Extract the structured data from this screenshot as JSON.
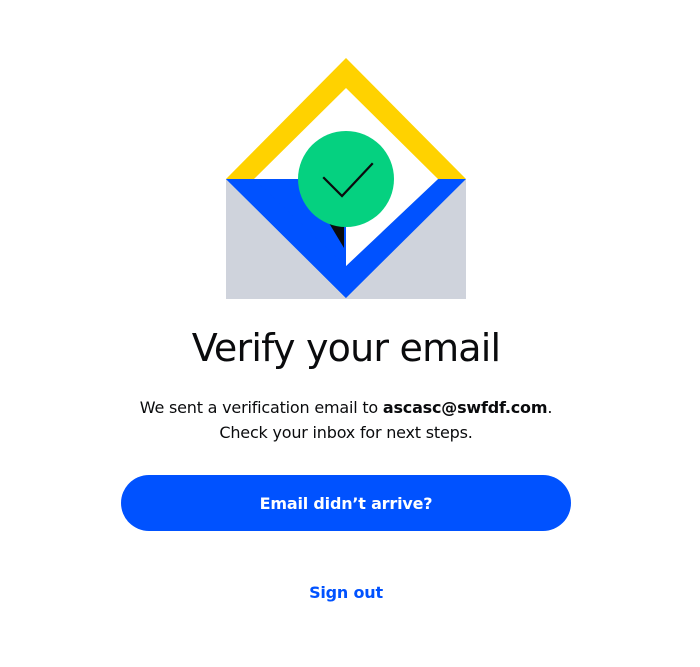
{
  "illustration": {
    "icon": "envelope-checkmark-icon",
    "colors": {
      "flap": "#ffd200",
      "envelope_body": "#cfd3dc",
      "envelope_front": "#0052ff",
      "check_circle": "#05d180",
      "letter": "#ffffff",
      "shadow": "#0a0b0d"
    }
  },
  "page": {
    "title": "Verify your email",
    "message_before": "We sent a verification email to ",
    "email": "ascasc@swfdf.com",
    "message_after": ". Check your inbox for next steps."
  },
  "actions": {
    "resend_label": "Email didn’t arrive?",
    "sign_out_label": "Sign out"
  },
  "theme": {
    "accent": "#0052ff",
    "text": "#0a0b0d",
    "background": "#ffffff"
  }
}
